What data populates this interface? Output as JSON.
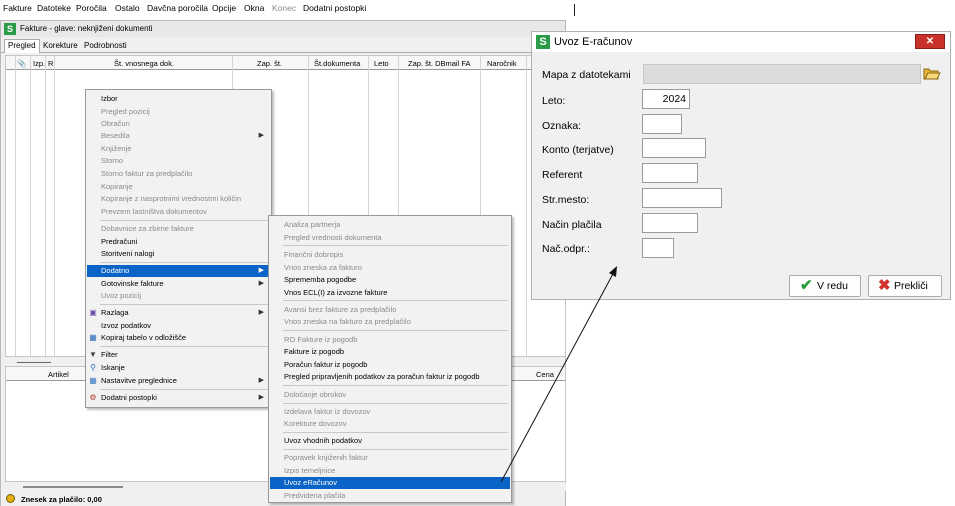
{
  "menubar": {
    "items": [
      {
        "label": "Fakture",
        "disabled": false
      },
      {
        "label": "Datoteke",
        "disabled": false
      },
      {
        "label": "Poročila",
        "disabled": false
      },
      {
        "label": "Ostalo",
        "disabled": false
      },
      {
        "label": "Davčna poročila",
        "disabled": false
      },
      {
        "label": "Opcije",
        "disabled": false
      },
      {
        "label": "Okna",
        "disabled": false
      },
      {
        "label": "Konec",
        "disabled": true
      },
      {
        "label": "Dodatni postopki",
        "disabled": false
      }
    ]
  },
  "main_window": {
    "title": "Fakture - glave: neknjiženi dokumenti",
    "tabs": [
      "Pregled",
      "Korekture",
      "Podrobnosti"
    ],
    "columns": [
      "Izp.",
      "R",
      "Št. vnosnega dok.",
      "Zap. št.",
      "Št.dokumenta",
      "Leto",
      "Zap. št. DBmail FA",
      "Naročnik"
    ],
    "lower_columns": [
      "Artikel",
      "Cena"
    ],
    "status": "Znesek za plačilo: 0,00"
  },
  "context_menu": {
    "items": [
      {
        "label": "Izbor",
        "disabled": false
      },
      {
        "label": "Pregled pozicij",
        "disabled": true
      },
      {
        "label": "Obračun",
        "disabled": true
      },
      {
        "label": "Besedila",
        "disabled": true,
        "submenu": true
      },
      {
        "label": "Knjiženje",
        "disabled": true
      },
      {
        "label": "Storno",
        "disabled": true
      },
      {
        "label": "Storno faktur za predplačilo",
        "disabled": true
      },
      {
        "label": "Kopiranje",
        "disabled": true
      },
      {
        "label": "Kopiranje z nasprotnimi vrednostmi količin",
        "disabled": true
      },
      {
        "label": "Prevzem lastništva dokumentov",
        "disabled": true
      },
      {
        "label": "Dobavnice za zbirne fakture",
        "disabled": true
      },
      {
        "label": "Predračuni",
        "disabled": false
      },
      {
        "label": "Storitveni nalogi",
        "disabled": false
      },
      {
        "label": "Dodatno",
        "disabled": false,
        "submenu": true,
        "selected": true
      },
      {
        "label": "Gotovinske fakture",
        "disabled": false,
        "submenu": true
      },
      {
        "label": "Uvoz pozicij",
        "disabled": true
      },
      {
        "label": "Razlaga",
        "disabled": false,
        "submenu": true,
        "icon": "help-book-icon"
      },
      {
        "label": "Izvoz podatkov",
        "disabled": false
      },
      {
        "label": "Kopiraj tabelo v odložišče",
        "disabled": false,
        "icon": "clipboard-icon"
      },
      {
        "label": "Filter",
        "disabled": false,
        "icon": "filter-icon"
      },
      {
        "label": "Iskanje",
        "disabled": false,
        "icon": "magnifier-icon"
      },
      {
        "label": "Nastavitve preglednice",
        "disabled": false,
        "submenu": true,
        "icon": "grid-settings-icon"
      },
      {
        "label": "Dodatni postopki",
        "disabled": false,
        "submenu": true,
        "icon": "gear-icon"
      }
    ]
  },
  "submenu": {
    "items": [
      {
        "label": "Analiza partnerja",
        "disabled": true
      },
      {
        "label": "Pregled vrednosti dokumenta",
        "disabled": true
      },
      {
        "label": "Finančni dobropis",
        "disabled": true
      },
      {
        "label": "Vnos zneska za fakturo",
        "disabled": true
      },
      {
        "label": "Sprememba pogodbe",
        "disabled": false
      },
      {
        "label": "Vnos ECL(I) za izvozne fakture",
        "disabled": false
      },
      {
        "label": "Avansi brez fakture za predplačilo",
        "disabled": true
      },
      {
        "label": "Vnos zneska na fakturo za predplačilo",
        "disabled": true
      },
      {
        "label": "RO Fakture iz pogodb",
        "disabled": true
      },
      {
        "label": "Fakture iz pogodb",
        "disabled": false
      },
      {
        "label": "Poračun faktur iz pogodb",
        "disabled": false
      },
      {
        "label": "Pregled pripravljenih podatkov za poračun faktur iz pogodb",
        "disabled": false
      },
      {
        "label": "Določanje obrokov",
        "disabled": true
      },
      {
        "label": "Izdelava faktur iz dovozov",
        "disabled": true
      },
      {
        "label": "Korekture dovozov",
        "disabled": true
      },
      {
        "label": "Uvoz vhodnih podatkov",
        "disabled": false
      },
      {
        "label": "Popravek knjiženih faktur",
        "disabled": true
      },
      {
        "label": "Izpis temeljnice",
        "disabled": true
      },
      {
        "label": "Uvoz eRačunov",
        "disabled": false,
        "selected": true
      },
      {
        "label": "Predvidena plačila",
        "disabled": true
      }
    ]
  },
  "dialog": {
    "title": "Uvoz E-računov",
    "close_label": "✕",
    "fields": {
      "mapa_label": "Mapa z datotekami",
      "mapa_value": "",
      "leto_label": "Leto:",
      "leto_value": "2024",
      "oznaka_label": "Oznaka:",
      "oznaka_value": "",
      "konto_label": "Konto (terjatve)",
      "konto_value": "",
      "referent_label": "Referent",
      "referent_value": "",
      "strmesto_label": "Str.mesto:",
      "strmesto_value": "",
      "nacin_label": "Način plačila",
      "nacin_value": "",
      "nacodpr_label": "Nač.odpr.:",
      "nacodpr_value": ""
    },
    "ok_label": "V redu",
    "cancel_label": "Prekliči"
  },
  "colors": {
    "selection": "#0a64c8",
    "logo_green": "#2a9b48",
    "close_red": "#c8322a"
  }
}
